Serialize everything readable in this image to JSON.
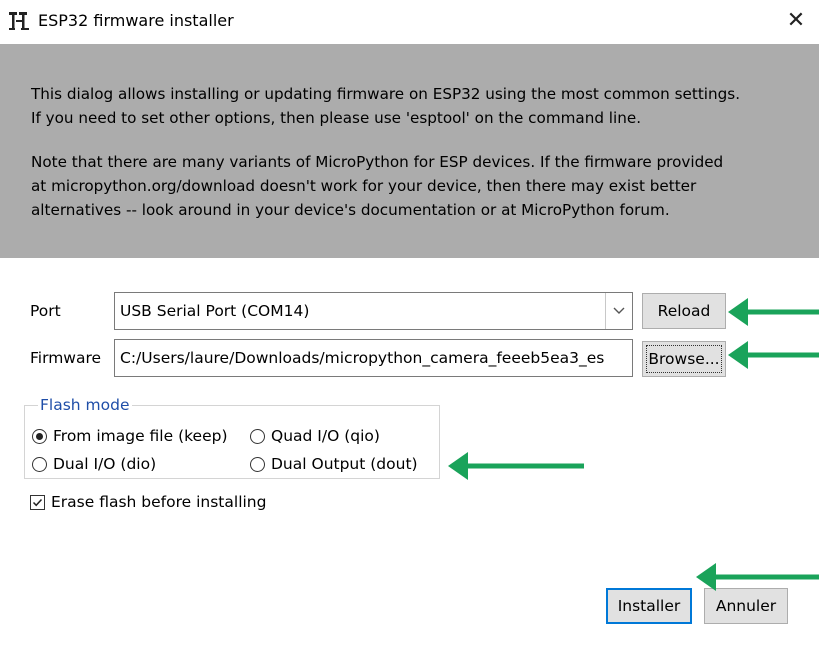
{
  "window": {
    "title": "ESP32 firmware installer",
    "close_glyph": "✕",
    "icon": "thonny-app-icon"
  },
  "info": {
    "paragraph1_line1": "This dialog allows installing or updating firmware on ESP32 using the most common settings.",
    "paragraph1_line2": "If you need to set other options, then please use 'esptool' on the command line.",
    "paragraph2_line1": "Note that there are many variants of MicroPython for ESP devices. If the firmware provided",
    "paragraph2_line2": "at micropython.org/download doesn't work for your device, then there may exist better",
    "paragraph2_line3": "alternatives -- look around in your device's documentation or at MicroPython forum."
  },
  "port": {
    "label": "Port",
    "value": "USB Serial Port (COM14)",
    "reload_label": "Reload"
  },
  "firmware": {
    "label": "Firmware",
    "value": "C:/Users/laure/Downloads/micropython_camera_feeeb5ea3_es",
    "browse_label": "Browse..."
  },
  "flash_mode": {
    "title": "Flash mode",
    "options": [
      {
        "label": "From image file (keep)",
        "selected": true
      },
      {
        "label": "Quad I/O (qio)",
        "selected": false
      },
      {
        "label": "Dual I/O (dio)",
        "selected": false
      },
      {
        "label": "Dual Output (dout)",
        "selected": false
      }
    ]
  },
  "erase": {
    "label": "Erase flash before installing",
    "checked": true
  },
  "actions": {
    "install_label": "Installer",
    "cancel_label": "Annuler"
  },
  "colors": {
    "info_bg": "#acacac",
    "arrow": "#1aa35a",
    "focus_border": "#0078d7",
    "group_title": "#1f4ea8"
  }
}
